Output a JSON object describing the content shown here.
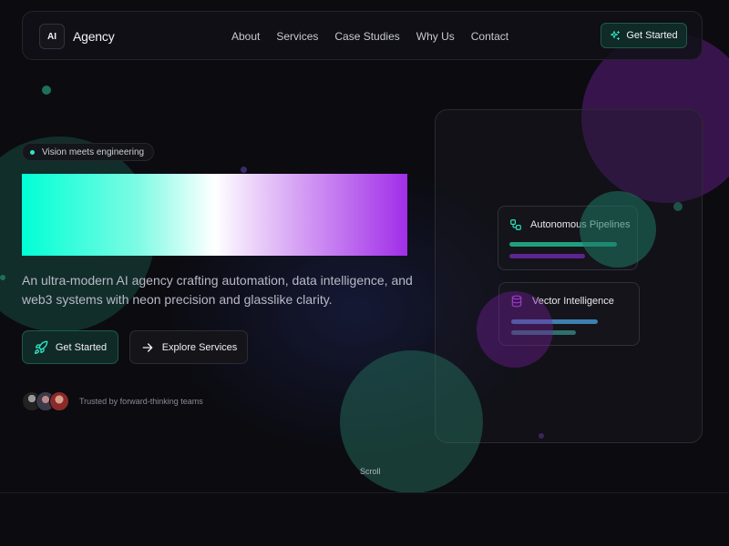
{
  "header": {
    "logo_text": "AI",
    "brand": "Agency",
    "nav": [
      "About",
      "Services",
      "Case Studies",
      "Why Us",
      "Contact"
    ],
    "cta_label": "Get Started"
  },
  "hero": {
    "badge": "Vision meets engineering",
    "subtitle": "An ultra-modern AI agency crafting automation, data intelligence, and web3 systems with neon precision and glasslike clarity.",
    "primary_button": "Get Started",
    "secondary_button": "Explore Services",
    "trusted_text": "Trusted by forward-thinking teams"
  },
  "panel": {
    "cards": [
      {
        "title": "Autonomous Pipelines",
        "icon": "workflow-icon"
      },
      {
        "title": "Vector Intelligence",
        "icon": "database-icon"
      }
    ]
  },
  "footer": {
    "scroll_label": "Scroll"
  },
  "colors": {
    "accent_teal": "#2ee6c4",
    "accent_purple": "#a12ee8",
    "background": "#0b0b10"
  }
}
